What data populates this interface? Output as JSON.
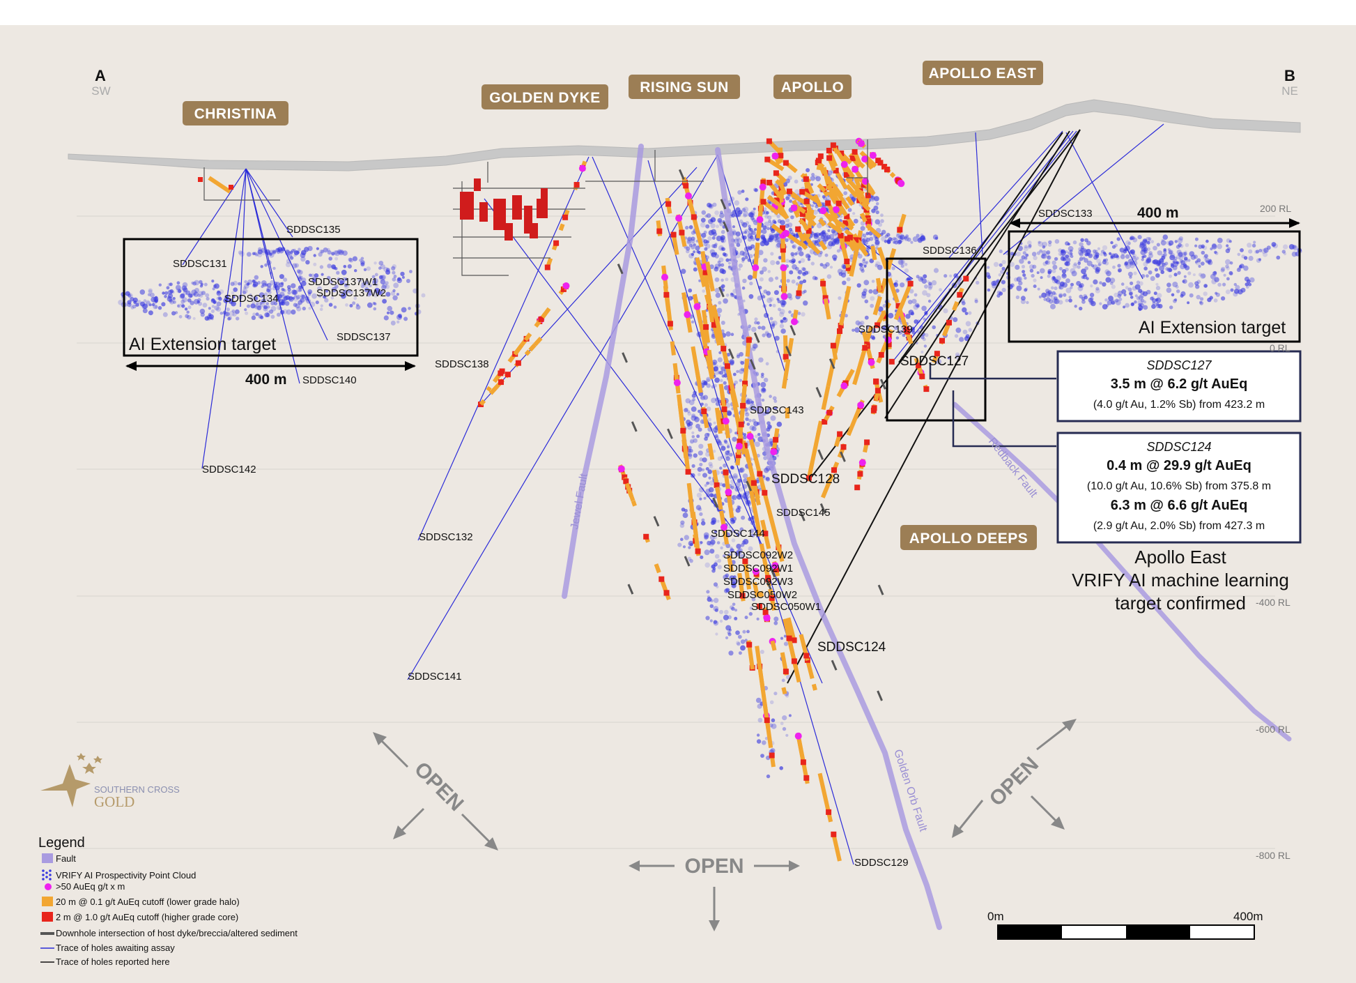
{
  "corners": {
    "a_letter": "A",
    "a_dir": "SW",
    "b_letter": "B",
    "b_dir": "NE"
  },
  "area_labels": {
    "christina": "CHRISTINA",
    "golden_dyke": "GOLDEN DYKE",
    "rising_sun": "RISING SUN",
    "apollo": "APOLLO",
    "apollo_east": "APOLLO EAST",
    "apollo_deeps": "APOLLO DEEPS"
  },
  "rl_labels": {
    "rl_200": "200 RL",
    "rl_0": "0 RL",
    "rl_m400": "-400 RL",
    "rl_m600": "-600 RL",
    "rl_m800": "-800 RL"
  },
  "targets": {
    "left": {
      "label": "AI Extension target",
      "width_label": "400 m"
    },
    "right": {
      "label": "AI Extension target",
      "width_label": "400 m"
    }
  },
  "drillholes": {
    "sddsc131": "SDDSC131",
    "sddsc135": "SDDSC135",
    "sddsc134": "SDDSC134",
    "sddsc137w1": "SDDSC137W1",
    "sddsc137w2": "SDDSC137W2",
    "sddsc137": "SDDSC137",
    "sddsc140": "SDDSC140",
    "sddsc142": "SDDSC142",
    "sddsc138": "SDDSC138",
    "sddsc132": "SDDSC132",
    "sddsc141": "SDDSC141",
    "sddsc143": "SDDSC143",
    "sddsc128": "SDDSC128",
    "sddsc145": "SDDSC145",
    "sddsc144": "SDDSC144",
    "sddsc092w2": "SDDSC092W2",
    "sddsc092w1": "SDDSC092W1",
    "sddsc092w3": "SDDSC092W3",
    "sddsc050w2": "SDDSC050W2",
    "sddsc050w1": "SDDSC050W1",
    "sddsc124": "SDDSC124",
    "sddsc129": "SDDSC129",
    "sddsc133": "SDDSC133",
    "sddsc136": "SDDSC136",
    "sddsc139": "SDDSC139",
    "sddsc127": "SDDSC127"
  },
  "callouts": {
    "c127": {
      "hole": "SDDSC127",
      "line1": "3.5 m @ 6.2 g/t AuEq",
      "line2": "(4.0 g/t Au, 1.2% Sb) from 423.2 m"
    },
    "c124": {
      "hole": "SDDSC124",
      "line1": "0.4 m @ 29.9 g/t AuEq",
      "line2": "(10.0 g/t Au, 10.6% Sb) from 375.8 m",
      "line3": "6.3 m @ 6.6 g/t AuEq",
      "line4": "(2.9 g/t Au, 2.0% Sb) from 427.3 m"
    }
  },
  "confirmation": {
    "line1": "Apollo East",
    "line2": "VRIFY AI machine learning",
    "line3": "target confirmed"
  },
  "faults": {
    "jewel": "Jewel Fault",
    "redback": "Redback Fault",
    "golden_orb": "Golden Orb Fault"
  },
  "open_label": "OPEN",
  "scale_bar": {
    "start": "0m",
    "end": "400m"
  },
  "logo": {
    "line1": "SOUTHERN CROSS",
    "line2": "GOLD"
  },
  "legend": {
    "title": "Legend",
    "items": [
      "Fault",
      "VRIFY AI Prospectivity Point Cloud",
      ">50 AuEq g/t x m",
      "20 m @ 0.1 g/t AuEq cutoff (lower grade halo)",
      "2 m @ 1.0 g/t AuEq cutoff (higher grade core)",
      "Downhole intersection of host dyke/breccia/altered sediment",
      "Trace of holes awaiting assay",
      "Trace of holes reported here"
    ]
  },
  "colors": {
    "background": "#ede8e2",
    "label_box": "#9c7e55",
    "fault": "#a99be0",
    "point_cloud": "#3a3ae0",
    "halo": "#f2a632",
    "core": "#e8251c",
    "magenta": "#ee22ee",
    "trace_awaiting": "#2a2ad8",
    "trace_reported": "#111111",
    "callout_border": "#262b52"
  }
}
